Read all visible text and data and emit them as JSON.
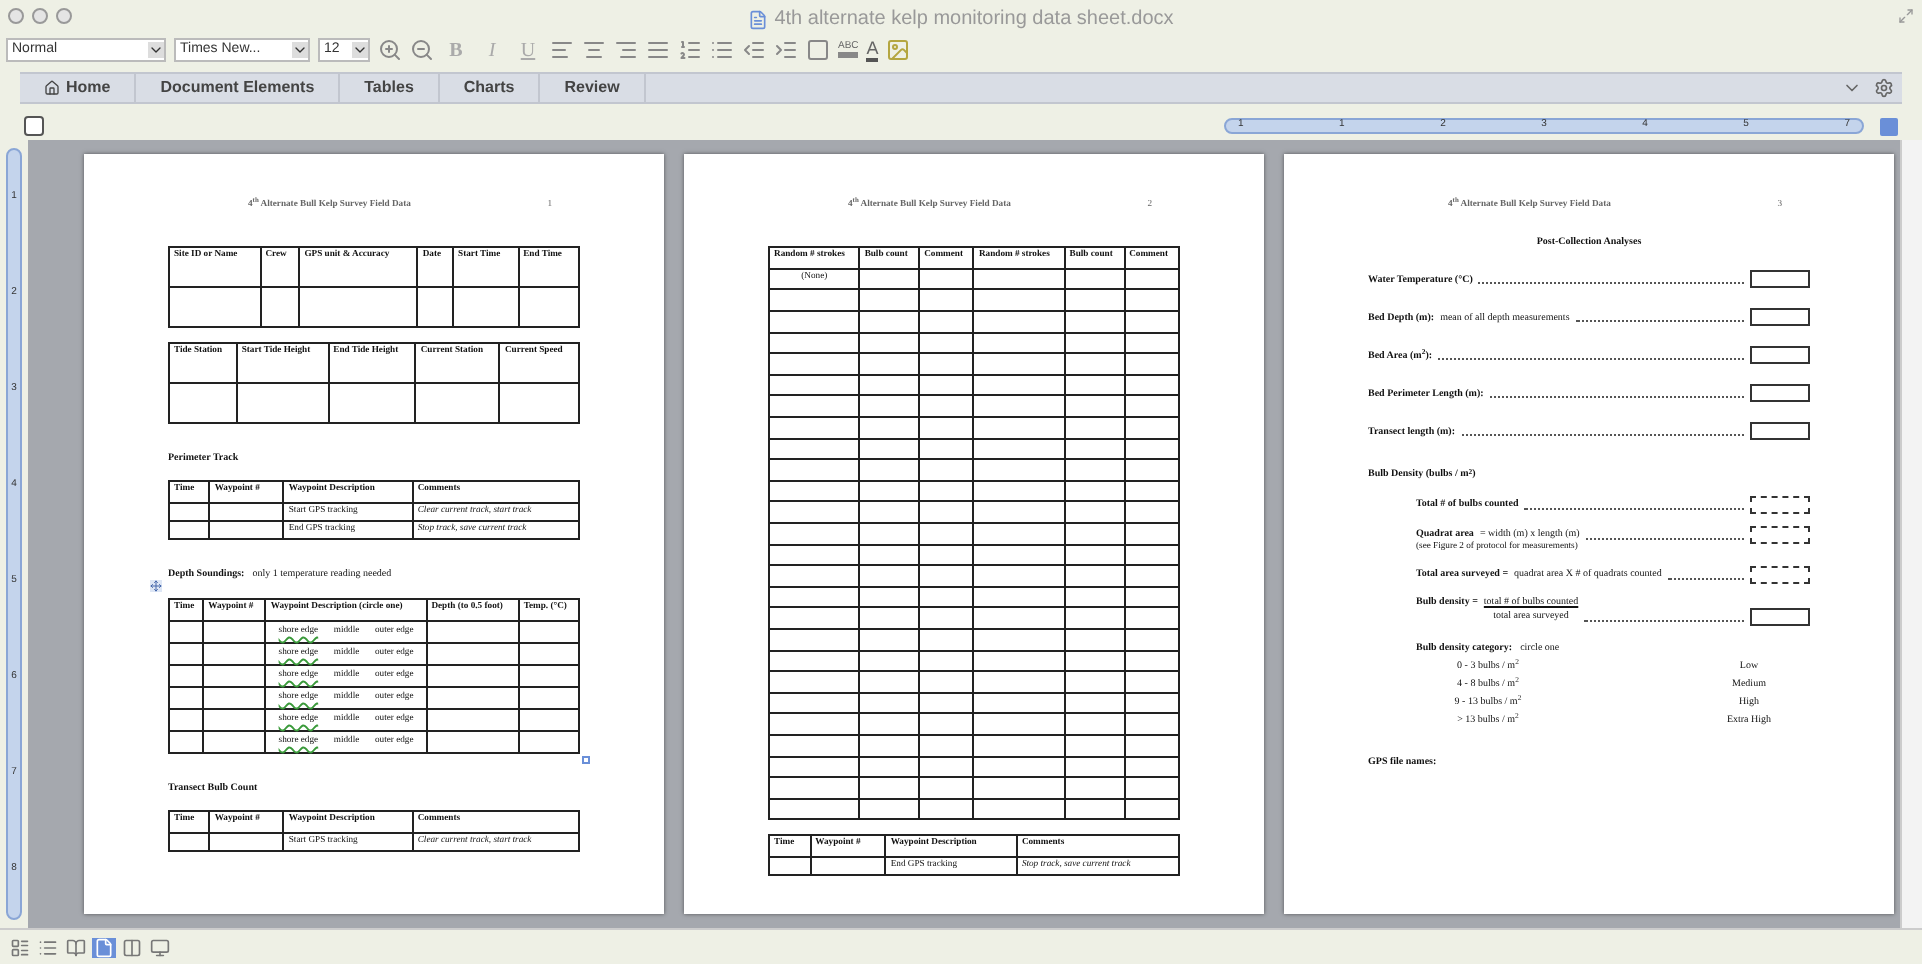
{
  "window": {
    "title": "4th alternate kelp monitoring data sheet.docx"
  },
  "toolbar": {
    "style": "Normal",
    "font": "Times New...",
    "size": "12",
    "format_buttons": [
      "B",
      "I",
      "U"
    ],
    "highlight": "ABC",
    "font_color": "A"
  },
  "ribbon_tabs": [
    {
      "label": "Home"
    },
    {
      "label": "Document Elements"
    },
    {
      "label": "Tables"
    },
    {
      "label": "Charts"
    },
    {
      "label": "Review"
    }
  ],
  "ruler": {
    "labels": [
      "1",
      "1",
      "2",
      "3",
      "4",
      "5",
      "7"
    ]
  },
  "vertical_ruler": {
    "labels": [
      "1",
      "2",
      "3",
      "4",
      "5",
      "6",
      "7",
      "8"
    ]
  },
  "pages": [
    {
      "header": "4$^{th}$ Alternate Bull Kelp Survey Field Data",
      "page_number": "1",
      "blocks": [
        {
          "kind": "form_table",
          "columns": [
            "Site ID or Name",
            "Crew",
            "GPS unit & Accuracy",
            "Date",
            "Start Time",
            "End Time"
          ],
          "rows": [
            {
              "kind": "blank"
            }
          ]
        },
        {
          "kind": "form_table",
          "columns": [
            "Tide Station",
            "Start Tide Height",
            "End Tide Height",
            "Current Station",
            "Current Speed"
          ],
          "rows": [
            {
              "kind": "blank"
            }
          ]
        },
        {
          "kind": "heading",
          "text": "Perimeter Track"
        },
        {
          "kind": "table",
          "columns": [
            "Time",
            "Waypoint #",
            "Waypoint Description",
            "Comments"
          ],
          "rows": [
            {
              "kind": "tracking",
              "description": "Start GPS tracking",
              "comment": "Clear current track, start track"
            },
            {
              "kind": "tracking",
              "description": "End GPS tracking",
              "comment": "Stop track, save current track"
            }
          ]
        },
        {
          "kind": "heading",
          "text": "Depth Soundings:",
          "hint": "only 1 temperature reading needed"
        },
        {
          "kind": "selected_table",
          "columns": [
            "Time",
            "Waypoint #",
            "Waypoint Description (circle one)",
            "Depth (to 0.5 foot)",
            "Temp. (°C)"
          ],
          "rows": [
            {
              "kind": "options",
              "options": [
                "shore edge",
                "middle",
                "outer edge"
              ]
            },
            {
              "kind": "options",
              "options": [
                "shore edge",
                "middle",
                "outer edge"
              ]
            },
            {
              "kind": "options",
              "options": [
                "shore edge",
                "middle",
                "outer edge"
              ]
            },
            {
              "kind": "options",
              "options": [
                "shore edge",
                "middle",
                "outer edge"
              ]
            },
            {
              "kind": "options",
              "options": [
                "shore edge",
                "middle",
                "outer edge"
              ]
            },
            {
              "kind": "options",
              "options": [
                "shore edge",
                "middle",
                "outer edge"
              ]
            }
          ]
        },
        {
          "kind": "heading",
          "text": "Transect Bulb Count"
        },
        {
          "kind": "table",
          "columns": [
            "Time",
            "Waypoint #",
            "Waypoint Description",
            "Comments"
          ],
          "rows": [
            {
              "kind": "tracking",
              "description": "Start GPS tracking",
              "comment": "Clear current track, start track"
            }
          ]
        }
      ]
    },
    {
      "header": "4$^{th}$ Alternate Bull Kelp Survey Field Data",
      "page_number": "2",
      "blocks": [
        {
          "kind": "table",
          "columns": [
            "Random # strokes",
            "Bulb count",
            "Comment",
            "Random # strokes",
            "Bulb count",
            "Comment"
          ],
          "rows": [
            {
              "kind": "note",
              "text": "(None)"
            },
            {
              "kind": "blank"
            },
            {
              "kind": "blank"
            },
            {
              "kind": "blank"
            },
            {
              "kind": "blank"
            },
            {
              "kind": "blank"
            },
            {
              "kind": "blank"
            },
            {
              "kind": "blank"
            },
            {
              "kind": "blank"
            },
            {
              "kind": "blank"
            },
            {
              "kind": "blank"
            },
            {
              "kind": "blank"
            },
            {
              "kind": "blank"
            },
            {
              "kind": "blank"
            },
            {
              "kind": "blank"
            },
            {
              "kind": "blank"
            },
            {
              "kind": "blank"
            },
            {
              "kind": "blank"
            },
            {
              "kind": "blank"
            },
            {
              "kind": "blank"
            },
            {
              "kind": "blank"
            },
            {
              "kind": "blank"
            },
            {
              "kind": "blank"
            },
            {
              "kind": "blank"
            },
            {
              "kind": "blank"
            },
            {
              "kind": "blank"
            }
          ]
        },
        {
          "kind": "table",
          "columns": [
            "Time",
            "Waypoint #",
            "Waypoint Description",
            "Comments"
          ],
          "rows": [
            {
              "kind": "tracking",
              "description": "End GPS tracking",
              "comment": "Stop track, save current track"
            }
          ]
        }
      ]
    },
    {
      "header": "4$^{th}$ Alternate Bull Kelp Survey Field Data",
      "page_number": "3",
      "blocks": [
        {
          "kind": "title",
          "text": "Post-Collection Analyses"
        },
        {
          "kind": "field",
          "label": "Water Temperature (°C)"
        },
        {
          "kind": "field",
          "label": "Bed Depth (m):",
          "hint": "mean of all depth measurements"
        },
        {
          "kind": "field",
          "label": "Bed Area (m$^{2}$):"
        },
        {
          "kind": "field",
          "label": "Bed Perimeter  Length (m):"
        },
        {
          "kind": "field",
          "label": "Transect length (m):"
        },
        {
          "kind": "heading",
          "text": "Bulb Density (bulbs / m$^{2}$)"
        },
        {
          "kind": "subfield",
          "label": "Total # of bulbs counted"
        },
        {
          "kind": "subfield",
          "label": "Quadrat area",
          "hint": "= width (m) x length (m)",
          "note": "(see Figure 2 of protocol for measurements)"
        },
        {
          "kind": "subfield",
          "label": "Total area surveyed =",
          "hint": "quadrat area X # of quadrats counted"
        },
        {
          "kind": "formula",
          "label": "Bulb density =",
          "numerator": "total # of bulbs counted",
          "denominator": "total area surveyed"
        },
        {
          "kind": "subheading",
          "text": "Bulb density category:",
          "hint": "circle one"
        },
        {
          "kind": "category",
          "range": "0 - 3 bulbs / m$^{2}$",
          "level": "Low"
        },
        {
          "kind": "category",
          "range": "4 - 8 bulbs / m$^{2}$",
          "level": "Medium"
        },
        {
          "kind": "category",
          "range": "9 - 13 bulbs / m$^{2}$",
          "level": "High"
        },
        {
          "kind": "category",
          "range": "> 13 bulbs / m$^{2}$",
          "level": "Extra High"
        },
        {
          "kind": "heading",
          "text": "GPS file names:"
        }
      ]
    }
  ]
}
